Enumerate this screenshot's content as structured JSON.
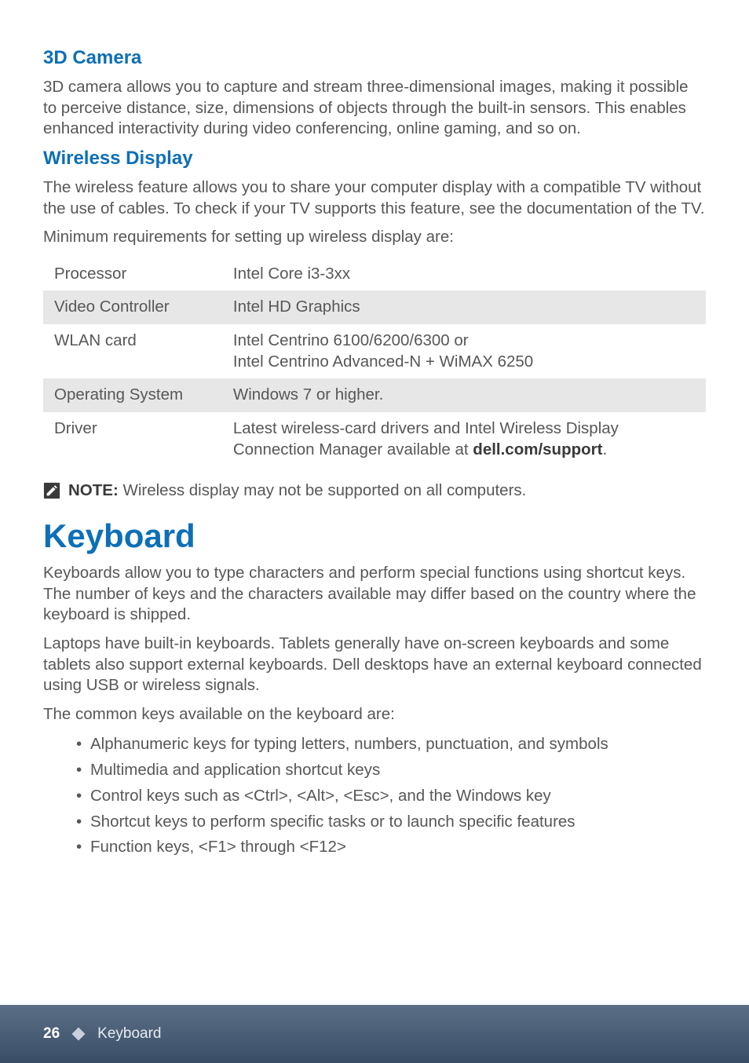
{
  "section1": {
    "heading": "3D Camera",
    "paragraph": "3D camera allows you to capture and stream three-dimensional images, making it possible to perceive distance, size, dimensions of objects through the built-in sensors. This enables enhanced interactivity during video conferencing, online gaming, and so on."
  },
  "section2": {
    "heading": "Wireless Display",
    "paragraph1": "The wireless feature allows you to share your computer display with a compatible TV without the use of cables. To check if your TV supports this feature, see the documentation of the TV.",
    "paragraph2": "Minimum requirements for setting up wireless display are:"
  },
  "table": {
    "rows": [
      {
        "label": "Processor",
        "value": "Intel Core i3-3xx"
      },
      {
        "label": "Video Controller",
        "value": "Intel HD Graphics"
      },
      {
        "label": "WLAN card",
        "value": "Intel Centrino 6100/6200/6300 or\nIntel Centrino Advanced-N + WiMAX 6250"
      },
      {
        "label": "Operating System",
        "value": "Windows 7 or higher."
      },
      {
        "label": "Driver",
        "value_prefix": "Latest wireless-card drivers and Intel Wireless Display Connection Manager available at ",
        "value_bold": "dell.com/support",
        "value_suffix": "."
      }
    ]
  },
  "note": {
    "label": "NOTE:",
    "text": " Wireless display may not be supported on all computers."
  },
  "section3": {
    "heading": "Keyboard",
    "paragraph1": "Keyboards allow you to type characters and perform special functions using shortcut keys. The number of keys and the characters available may differ based on the country where the keyboard is shipped.",
    "paragraph2": "Laptops have built-in keyboards. Tablets generally have on-screen keyboards and some tablets also support external keyboards. Dell desktops have an external keyboard connected using USB or wireless signals.",
    "paragraph3": "The common keys available on the keyboard are:",
    "bullets": [
      "Alphanumeric keys for typing letters, numbers, punctuation, and symbols",
      "Multimedia and application shortcut keys",
      "Control keys such as <Ctrl>, <Alt>, <Esc>, and the Windows key",
      "Shortcut keys to perform specific tasks or to launch specific features",
      "Function keys, <F1> through <F12>"
    ]
  },
  "footer": {
    "page": "26",
    "title": "Keyboard"
  }
}
